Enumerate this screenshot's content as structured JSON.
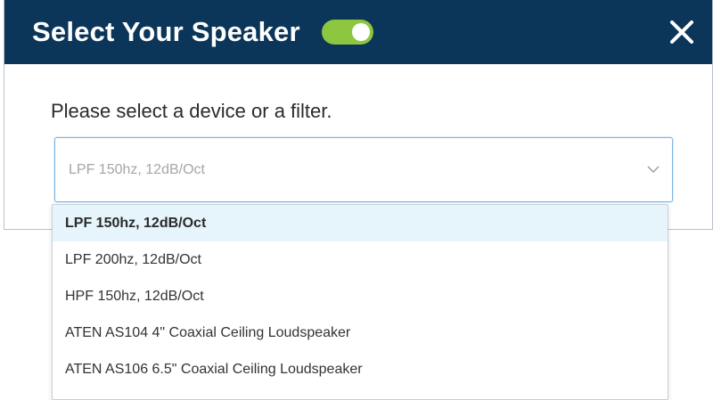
{
  "dialog": {
    "title": "Select Your Speaker",
    "prompt": "Please select a device or a filter.",
    "toggle_on": true
  },
  "select": {
    "value": "LPF 150hz, 12dB/Oct"
  },
  "options": [
    {
      "label": "LPF 150hz, 12dB/Oct",
      "selected": true
    },
    {
      "label": "LPF 200hz, 12dB/Oct",
      "selected": false
    },
    {
      "label": "HPF 150hz, 12dB/Oct",
      "selected": false
    },
    {
      "label": "ATEN AS104 4\" Coaxial Ceiling Loudspeaker",
      "selected": false
    },
    {
      "label": "ATEN AS106 6.5\" Coaxial Ceiling Loudspeaker",
      "selected": false
    }
  ],
  "colors": {
    "header_bg": "#0b3659",
    "toggle_on": "#8dc63f",
    "highlight": "#e6f4fb",
    "focus_border": "#7fb6e8"
  },
  "icons": {
    "close": "close-icon",
    "chevron": "chevron-down-icon"
  }
}
